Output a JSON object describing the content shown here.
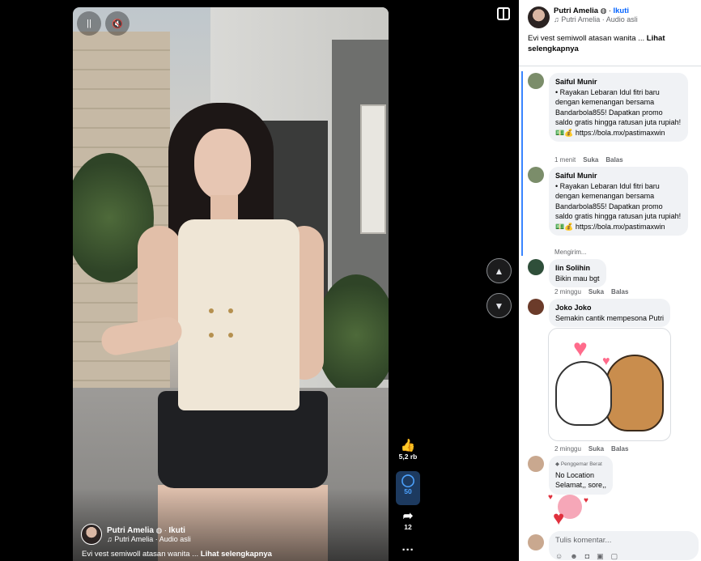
{
  "video": {
    "author": "Putri Amelia",
    "follow": "Ikuti",
    "audio": "Putri Amelia · Audio asli",
    "caption": "Evi vest semiwoll atasan wanita ...",
    "see_more": "Lihat selengkapnya"
  },
  "rail": {
    "likes": "5,2 rb",
    "comments": "50",
    "shares": "12"
  },
  "post": {
    "author": "Putri Amelia",
    "follow": "Ikuti",
    "audio": "Putri Amelia · Audio asli",
    "caption": "Evi vest semiwoll atasan wanita ...",
    "see_more": "Lihat selengkapnya"
  },
  "comments": [
    {
      "author": "Saiful Munir",
      "text": "• Rayakan Lebaran Idul fitri baru dengan kemenangan bersama Bandarbola855! Dapatkan promo saldo gratis hingga ratusan juta rupiah!💵💰 https://bola.mx/pastimaxwin",
      "time": "1 menit",
      "like": "Suka",
      "reply": "Balas"
    },
    {
      "author": "Saiful Munir",
      "text": "• Rayakan Lebaran Idul fitri baru dengan kemenangan bersama Bandarbola855! Dapatkan promo saldo gratis hingga ratusan juta rupiah!💵💰 https://bola.mx/pastimaxwin",
      "time": "Mengirim..."
    },
    {
      "author": "Iin Solihin",
      "text": "Bikin mau bgt",
      "time": "2 minggu",
      "like": "Suka",
      "reply": "Balas"
    },
    {
      "author": "Joko Joko",
      "text": "Semakin cantik mempesona Putri",
      "time": "2 minggu",
      "like": "Suka",
      "reply": "Balas"
    },
    {
      "badge": "Penggemar Berat",
      "author": "No Location",
      "text": "Selamat,, sore,,"
    }
  ],
  "input": {
    "placeholder": "Tulis komentar..."
  },
  "colors": {
    "accent": "#0866ff",
    "bubble": "#f0f2f5",
    "muted": "#65676b"
  }
}
